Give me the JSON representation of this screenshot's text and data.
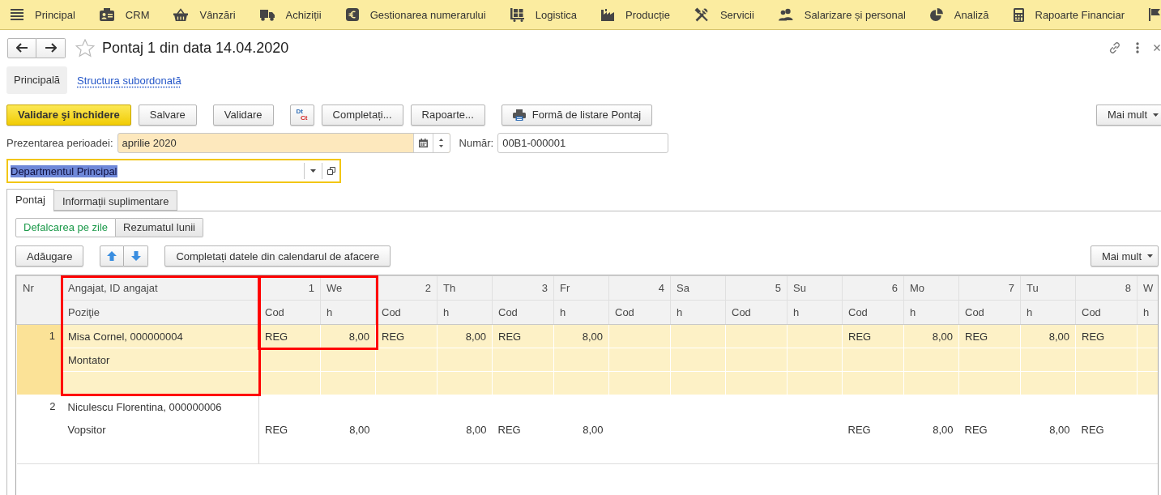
{
  "menu": [
    "Principal",
    "CRM",
    "Vânzări",
    "Achiziții",
    "Gestionarea numerarului",
    "Logistica",
    "Producție",
    "Servicii",
    "Salarizare și personal",
    "Analiză",
    "Rapoarte Financiar"
  ],
  "header": {
    "title": "Pontaj 1 din data 14.04.2020",
    "favorite": false
  },
  "sections": [
    {
      "label": "Principală",
      "selected": true
    },
    {
      "label": "Structura subordonată",
      "selected": false
    }
  ],
  "toolbar": {
    "groups": [
      [
        {
          "kind": "default",
          "label": "Validare şi închidere"
        },
        {
          "kind": "plain",
          "label": "Salvare"
        }
      ],
      [
        {
          "kind": "plain",
          "label": "Validare"
        }
      ],
      [
        {
          "kind": "accounting",
          "top": "Dt",
          "bottom": "Ct"
        },
        {
          "kind": "plain",
          "label": "Completați..."
        },
        {
          "kind": "plain",
          "label": "Rapoarte..."
        }
      ],
      [
        {
          "kind": "print",
          "label": "Formă de listare Pontaj"
        }
      ]
    ],
    "more": "Mai mult"
  },
  "period": {
    "label": "Prezentarea perioadei:",
    "value": "aprilie 2020"
  },
  "number": {
    "label": "Număr:",
    "value": "00B1-000001"
  },
  "department": {
    "value": "Departmentul Principal",
    "focused": true,
    "text_selected": true
  },
  "tabs": [
    {
      "label": "Pontaj",
      "selected": true
    },
    {
      "label": "Informații suplimentare",
      "selected": false
    }
  ],
  "view_mode": [
    {
      "label": "Defalcarea pe zile",
      "selected": true
    },
    {
      "label": "Rezumatul lunii",
      "selected": false
    }
  ],
  "table_toolbar": {
    "add": "Adăugare",
    "fill": "Completați datele din calendarul de afacere",
    "more": "Mai mult"
  },
  "table": {
    "columns": [
      {
        "heading": "Nr"
      },
      {
        "heading": "Angajat, ID angajat",
        "subheading": "Poziţie",
        "framed": true
      }
    ],
    "days": [
      {
        "kind": "workday",
        "number": "1",
        "weekday": "We",
        "code_heading": "Cod",
        "hours_heading": "h",
        "framed": true
      },
      {
        "kind": "workday",
        "number": "2",
        "weekday": "Th",
        "code_heading": "Cod",
        "hours_heading": "h"
      },
      {
        "kind": "workday",
        "number": "3",
        "weekday": "Fr",
        "code_heading": "Cod",
        "hours_heading": "h"
      },
      {
        "kind": "weekend",
        "number": "4",
        "weekday": "Sa",
        "code_heading": "Cod",
        "hours_heading": "h"
      },
      {
        "kind": "weekend",
        "number": "5",
        "weekday": "Su",
        "code_heading": "Cod",
        "hours_heading": "h"
      },
      {
        "kind": "workday",
        "number": "6",
        "weekday": "Mo",
        "code_heading": "Cod",
        "hours_heading": "h"
      },
      {
        "kind": "workday",
        "number": "7",
        "weekday": "Tu",
        "code_heading": "Cod",
        "hours_heading": "h"
      },
      {
        "kind": "workday",
        "number": "8",
        "weekday": "W",
        "code_heading": "Cod",
        "hours_heading": "h"
      }
    ],
    "rows": [
      {
        "number": "1",
        "selected": true,
        "lines": [
          {
            "text": "Misa Cornel, 000000004",
            "days": [
              {
                "code": "REG",
                "hours": "8,00"
              },
              {
                "code": "REG",
                "hours": "8,00"
              },
              {
                "code": "REG",
                "hours": "8,00"
              },
              {
                "code": "REG",
                "hours": "8,00"
              },
              {
                "code": "REG",
                "hours": "8,00"
              },
              {
                "code": "REG"
              }
            ]
          },
          {
            "text": "Montator"
          }
        ]
      },
      {
        "number": "2",
        "selected": false,
        "lines": [
          {
            "text": "Niculescu Florentina, 000000006"
          },
          {
            "text": "Vopsitor",
            "days": [
              {
                "code": "REG",
                "hours": "8,00"
              },
              {
                "hours": "8,00"
              },
              {
                "code": "REG",
                "hours": "8,00"
              },
              {
                "code": "REG",
                "hours": "8,00"
              },
              {
                "code": "REG",
                "hours": "8,00"
              },
              {
                "code": "REG"
              }
            ]
          }
        ]
      }
    ]
  }
}
